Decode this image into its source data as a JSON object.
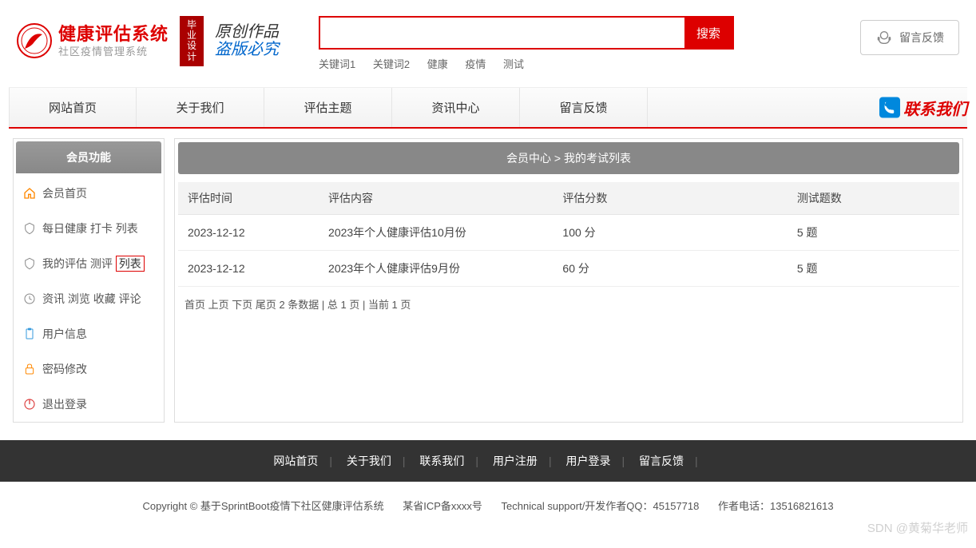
{
  "header": {
    "logo_title": "健康评估系统",
    "logo_subtitle": "社区疫情管理系统",
    "badge": "毕业设计",
    "script_line1": "原创作品",
    "script_line2": "盗版必究",
    "search_placeholder": "",
    "search_button": "搜索",
    "keywords": [
      "关键词1",
      "关键词2",
      "健康",
      "疫情",
      "测试"
    ],
    "feedback_label": "留言反馈"
  },
  "nav": {
    "items": [
      "网站首页",
      "关于我们",
      "评估主题",
      "资讯中心",
      "留言反馈"
    ],
    "contact": "联系我们"
  },
  "sidebar": {
    "header": "会员功能",
    "items": [
      {
        "label": "会员首页"
      },
      {
        "label": "每日健康 打卡 列表"
      },
      {
        "label_pre": "我的评估 测评 ",
        "label_hl": "列表"
      },
      {
        "label": "资讯 浏览 收藏 评论"
      },
      {
        "label": "用户信息"
      },
      {
        "label": "密码修改"
      },
      {
        "label": "退出登录"
      }
    ]
  },
  "content": {
    "breadcrumb": "会员中心 > 我的考试列表",
    "columns": [
      "评估时间",
      "评估内容",
      "评估分数",
      "测试题数"
    ],
    "rows": [
      {
        "time": "2023-12-12",
        "content": "2023年个人健康评估10月份",
        "score": "100 分",
        "count": "5 题"
      },
      {
        "time": "2023-12-12",
        "content": "2023年个人健康评估9月份",
        "score": "60 分",
        "count": "5 题"
      }
    ],
    "pagination": "首页 上页 下页 尾页 2 条数据 | 总 1 页 | 当前 1 页"
  },
  "footer": {
    "links": [
      "网站首页",
      "关于我们",
      "联系我们",
      "用户注册",
      "用户登录",
      "留言反馈"
    ],
    "copyright_prefix": "Copyright © 基于SprintBoot疫情下社区健康评估系统",
    "icp": "某省ICP备xxxx号",
    "tech": "Technical support/开发作者QQ：45157718",
    "phone": "作者电话：13516821613"
  },
  "watermark": "SDN @黄菊华老师"
}
